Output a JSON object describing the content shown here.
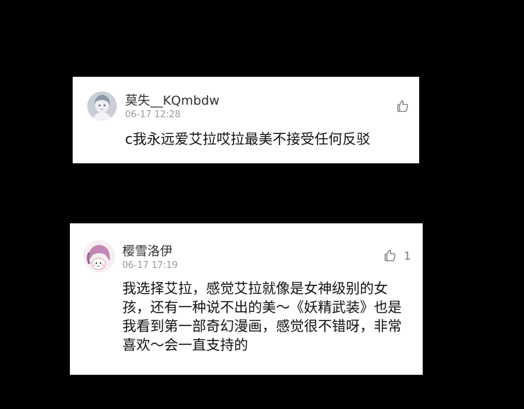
{
  "comments": [
    {
      "username": "莫失__KQmbdw",
      "time": "06-17 12:28",
      "text": "c我永远爱艾拉哎拉最美不接受任何反驳",
      "like_count": "",
      "avatar_icon": "anime-character-avatar-icon",
      "like_icon": "thumbs-up-icon"
    },
    {
      "username": "樱雪洛伊",
      "time": "06-17 17:19",
      "text": "我选择艾拉，感觉艾拉就像是女神级别的女孩，还有一种说不出的美～《妖精武装》也是我看到第一部奇幻漫画，感觉很不错呀，非常喜欢～会一直支持的",
      "like_count": "1",
      "avatar_icon": "anime-girl-avatar-icon",
      "like_icon": "thumbs-up-icon"
    }
  ],
  "colors": {
    "background": "#000000",
    "card": "#ffffff",
    "username": "#333333",
    "timestamp": "#9a9a9a",
    "text": "#111111",
    "icon": "#7a7a7a"
  }
}
